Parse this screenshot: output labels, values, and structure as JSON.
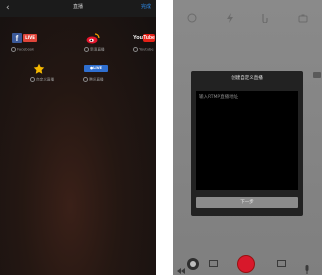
{
  "left": {
    "header": {
      "back_glyph": "‹",
      "title": "直播",
      "done": "完成"
    },
    "platforms": [
      {
        "icon": "facebook-live-icon",
        "badge": "LIVE",
        "label": "Facebook"
      },
      {
        "icon": "weibo-icon",
        "label": "新浪直播"
      },
      {
        "icon": "youtube-icon",
        "logo_text_you": "You",
        "logo_text_tube": "Tube",
        "label": "Youtube"
      },
      {
        "icon": "star-icon",
        "label": "自定义直播"
      },
      {
        "icon": "qq-live-icon",
        "badge": "●LIVE",
        "label": "腾讯直播"
      }
    ],
    "colors": {
      "facebook": "#3b5998",
      "live_red": "#e0453a",
      "youtube_red": "#e62117",
      "weibo_red": "#e6162d",
      "star": "#f5b800",
      "qq_blue": "#2f6fd0",
      "accent_blue": "#2f8ff0"
    }
  },
  "right": {
    "dialog": {
      "title": "创建自定义直播",
      "placeholder": "输入RTMP直播地址",
      "button": "下一步"
    },
    "bottom_icons": [
      "rewind-icon",
      "gallery-icon",
      "record-button",
      "camera-icon",
      "mic-icon"
    ],
    "colors": {
      "record": "#d8182b"
    }
  }
}
